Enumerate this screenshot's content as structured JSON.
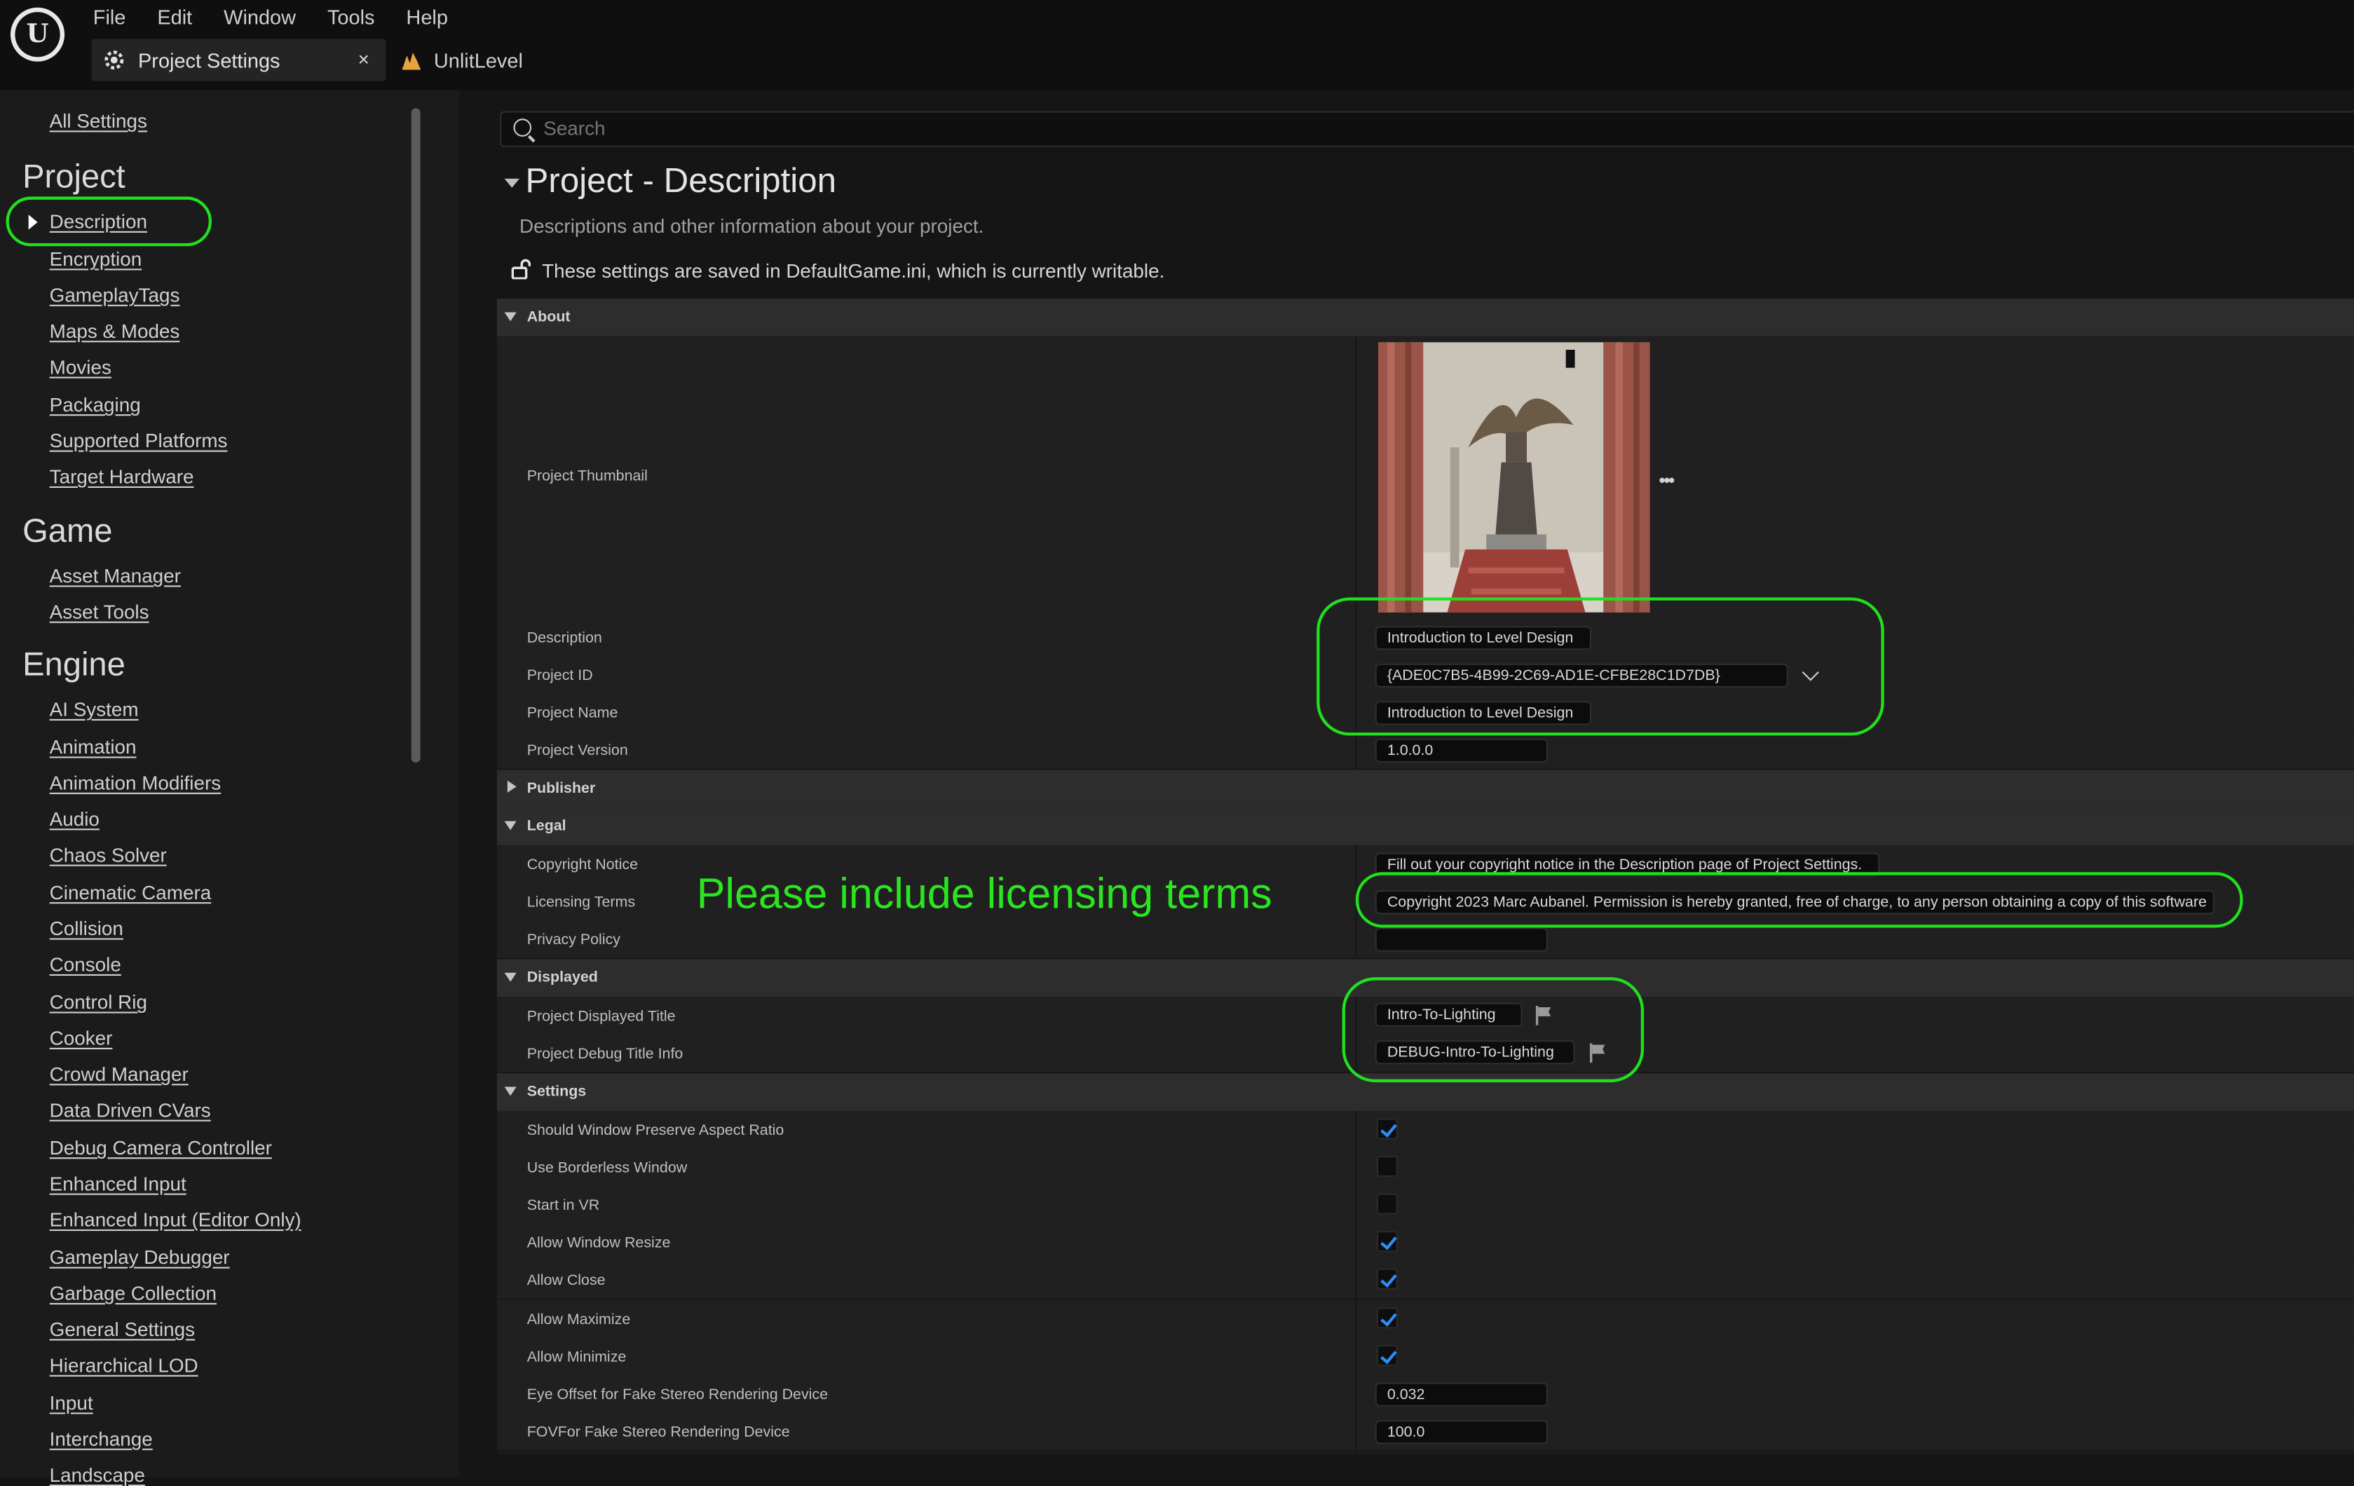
{
  "app": {
    "logo_text": "U",
    "menu": [
      "File",
      "Edit",
      "Window",
      "Tools",
      "Help"
    ],
    "tabs": [
      {
        "label": "Project Settings",
        "icon": "settings-cog-icon",
        "active": true,
        "close": "×"
      },
      {
        "label": "UnlitLevel",
        "icon": "level-icon",
        "active": false
      }
    ]
  },
  "sidebar": {
    "all_settings": "All Settings",
    "sections": [
      {
        "heading": "Project",
        "items": [
          "Description",
          "Encryption",
          "GameplayTags",
          "Maps & Modes",
          "Movies",
          "Packaging",
          "Supported Platforms",
          "Target Hardware"
        ],
        "selected": "Description"
      },
      {
        "heading": "Game",
        "items": [
          "Asset Manager",
          "Asset Tools"
        ]
      },
      {
        "heading": "Engine",
        "items": [
          "AI System",
          "Animation",
          "Animation Modifiers",
          "Audio",
          "Chaos Solver",
          "Cinematic Camera",
          "Collision",
          "Console",
          "Control Rig",
          "Cooker",
          "Crowd Manager",
          "Data Driven CVars",
          "Debug Camera Controller",
          "Enhanced Input",
          "Enhanced Input (Editor Only)",
          "Gameplay Debugger",
          "Garbage Collection",
          "General Settings",
          "Hierarchical LOD",
          "Input",
          "Interchange",
          "Landscape"
        ]
      }
    ]
  },
  "search": {
    "placeholder": "Search"
  },
  "page": {
    "title": "Project - Description",
    "subtitle": "Descriptions and other information about your project.",
    "saved_note": "These settings are saved in DefaultGame.ini, which is currently writable."
  },
  "about": {
    "heading": "About",
    "thumbnail_label": "Project Thumbnail",
    "more": "•••",
    "description_label": "Description",
    "description_value": "Introduction to Level Design",
    "project_id_label": "Project ID",
    "project_id_value": "{ADE0C7B5-4B99-2C69-AD1E-CFBE28C1D7DB}",
    "project_name_label": "Project Name",
    "project_name_value": "Introduction to Level Design",
    "project_version_label": "Project Version",
    "project_version_value": "1.0.0.0"
  },
  "publisher": {
    "heading": "Publisher"
  },
  "legal": {
    "heading": "Legal",
    "copyright_label": "Copyright Notice",
    "copyright_value": "Fill out your copyright notice in the Description page of Project Settings.",
    "licensing_label": "Licensing Terms",
    "licensing_value": "Copyright 2023  Marc Aubanel. Permission is hereby granted, free of charge, to any person obtaining a copy of this software",
    "privacy_label": "Privacy Policy",
    "privacy_value": ""
  },
  "displayed": {
    "heading": "Displayed",
    "title_label": "Project Displayed Title",
    "title_value": "Intro-To-Lighting",
    "debug_label": "Project Debug Title Info",
    "debug_value": "DEBUG-Intro-To-Lighting"
  },
  "settings": {
    "heading": "Settings",
    "checks": [
      {
        "label": "Should Window Preserve Aspect Ratio",
        "checked": true
      },
      {
        "label": "Use Borderless Window",
        "checked": false
      },
      {
        "label": "Start in VR",
        "checked": false
      },
      {
        "label": "Allow Window Resize",
        "checked": true
      },
      {
        "label": "Allow Close",
        "checked": true
      },
      {
        "label": "Allow Maximize",
        "checked": true
      },
      {
        "label": "Allow Minimize",
        "checked": true
      }
    ],
    "eye_offset_label": "Eye Offset for Fake Stereo Rendering Device",
    "eye_offset_value": "0.032",
    "fov_label": "FOVFor Fake Stereo Rendering Device",
    "fov_value": "100.0"
  },
  "annotation": {
    "text": "Please include licensing terms",
    "color": "#21e01e"
  },
  "colors": {
    "accent_check": "#2b8ef5",
    "annotation_green": "#21e01e",
    "background": "#151515"
  }
}
